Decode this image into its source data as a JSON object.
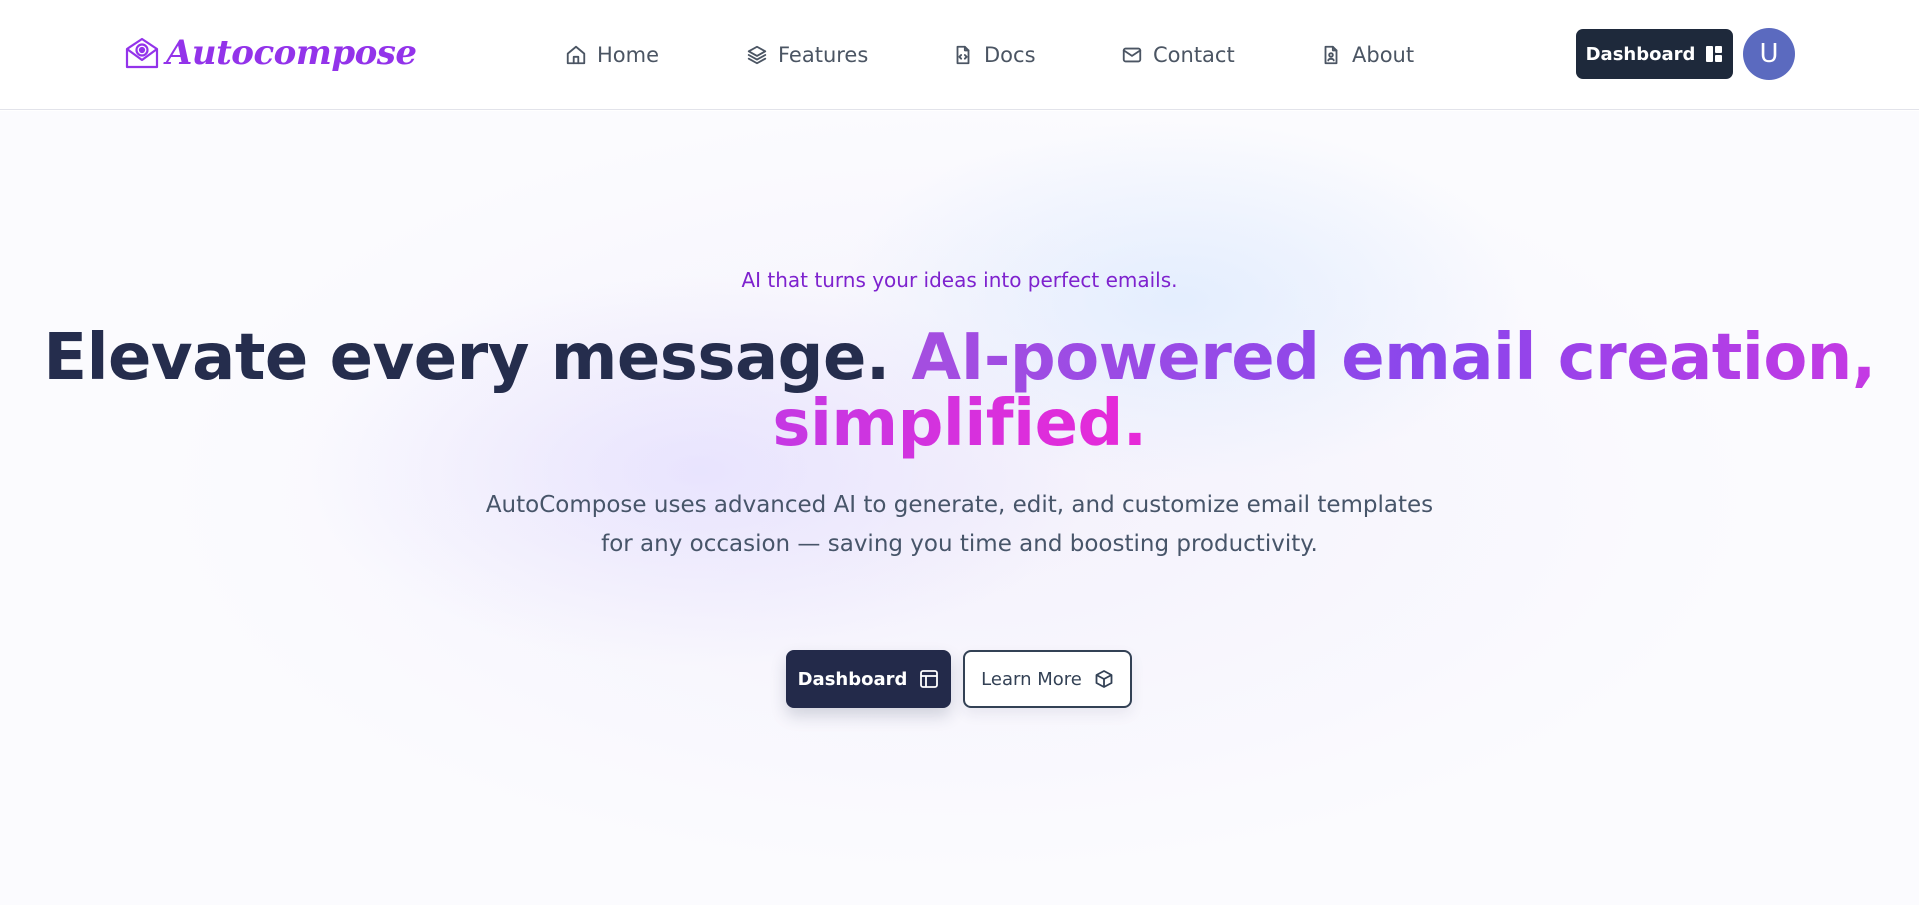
{
  "brand": {
    "name": "Autocompose",
    "color": "#9333ea"
  },
  "nav": [
    {
      "label": "Home",
      "icon": "home-icon"
    },
    {
      "label": "Features",
      "icon": "layers-icon"
    },
    {
      "label": "Docs",
      "icon": "file-code-icon"
    },
    {
      "label": "Contact",
      "icon": "mail-icon"
    },
    {
      "label": "About",
      "icon": "file-user-icon"
    }
  ],
  "header": {
    "dashboard_label": "Dashboard",
    "dashboard_icon": "layout-dashboard-icon",
    "avatar_initial": "U",
    "avatar_color": "#5b6abf"
  },
  "hero": {
    "tagline": "AI that turns your ideas into perfect emails.",
    "headline_dark": "Elevate every message.",
    "headline_gradient": "AI-powered email creation, simplified.",
    "subtext_line1": "AutoCompose uses advanced AI to generate, edit, and customize email templates",
    "subtext_line2": "for any occasion — saving you time and boosting productivity.",
    "primary_button": {
      "label": "Dashboard",
      "icon": "panels-icon"
    },
    "secondary_button": {
      "label": "Learn More",
      "icon": "box-icon"
    }
  },
  "colors": {
    "primary_dark": "#1e293b",
    "accent_purple": "#7e22ce",
    "gradient_start": "#a54ee0",
    "gradient_end": "#e729d8"
  }
}
